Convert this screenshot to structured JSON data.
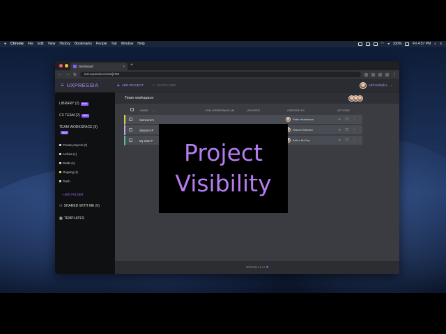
{
  "menubar": {
    "apple": "",
    "app": "Chrome",
    "items": [
      "File",
      "Edit",
      "View",
      "History",
      "Bookmarks",
      "People",
      "Tab",
      "Window",
      "Help"
    ],
    "battery": "100%",
    "clock": "Fri 4:57 PM"
  },
  "browser": {
    "tab_title": "Dashboard",
    "tab_close": "×",
    "new_tab": "+",
    "url": "test.uxpressia.com/w/jF2W"
  },
  "app": {
    "logo": "UXPRESSIA",
    "add_project": "ADD PROJECT",
    "invite_user": "INVITE USER",
    "user_name": "ARTHUR@LL"
  },
  "sidebar": {
    "library": "LIBRARY (2)",
    "library_badge": "NEW",
    "cx_team": "CX TEAM (2)",
    "cx_team_badge": "NEW",
    "team_workspace": "TEAM WORKSPACE (5)",
    "team_workspace_badge": "NEW",
    "folders": [
      {
        "label": "Private projects (0)"
      },
      {
        "label": "Archive (1)"
      },
      {
        "label": "Drafts (1)"
      },
      {
        "label": "Ongoing (1)"
      },
      {
        "label": "Trash"
      }
    ],
    "add_folder": "+ ADD FOLDER",
    "shared": "SHARED WITH ME (0)",
    "templates": "TEMPLATES"
  },
  "workspace": {
    "title": "Team workspace",
    "columns": {
      "name": "NAME",
      "csm": "CSM | PERSONAS | IM",
      "updated": "UPDATED",
      "created_by": "CREATED BY",
      "actions": "ACTIONS"
    },
    "rows": [
      {
        "name": "Someone's",
        "creator": "Peter Henderson",
        "color": "#d9d34a"
      },
      {
        "name": "Sharon's P",
        "creator": "Sharon Wheeler",
        "color": "#b9a9e8"
      },
      {
        "name": "My Own P",
        "creator": "Arthur McCay",
        "color": "#4fc38a"
      }
    ],
    "version": "VERSION 4.27.0"
  },
  "overlay": {
    "line1": "Project",
    "line2": "Visibility"
  },
  "colors": {
    "accent": "#8a5cf5",
    "overlay_text": "#b57cf0"
  }
}
